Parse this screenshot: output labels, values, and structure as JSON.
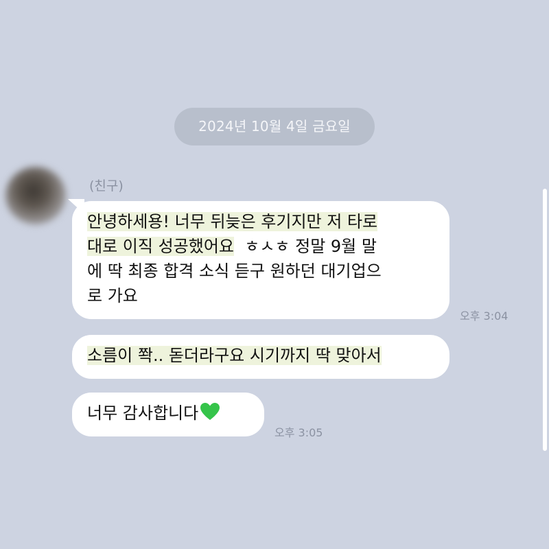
{
  "chat": {
    "date_label": "2024년 10월 4일 금요일",
    "sender_name": "(친구)",
    "messages": [
      {
        "lines": [
          "안녕하세용! 너무 뒤늦은 후기지만 저 타로",
          "대로 이직 성공했어요",
          "ㅎㅅㅎ 정말 9월 말",
          "에 딱 최종 합격 소식 듣구 원하던 대기업으",
          "로 가요"
        ],
        "time": "오후 3:04"
      },
      {
        "text": "소름이 쫙.. 돋더라구요 시기까지 딱 맞아서",
        "time": ""
      },
      {
        "text": "너무 감사합니다",
        "emoji": "green-heart-icon",
        "time": "오후 3:05"
      }
    ]
  },
  "colors": {
    "background": "#cdd3e1",
    "bubble": "#ffffff",
    "highlight": "#eef3dc",
    "heart": "#35c44a"
  }
}
